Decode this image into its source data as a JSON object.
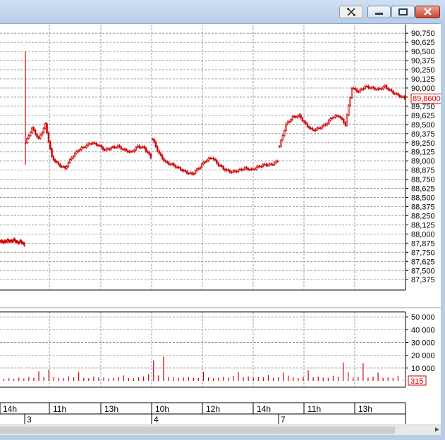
{
  "colors": {
    "candle": "#cc0000",
    "grid": "#888888",
    "text": "#000000",
    "current_price": "#cc0000"
  },
  "titlebar": {
    "icons": [
      "chart-layout-icon",
      "minimize-icon",
      "maximize-icon",
      "close-icon"
    ]
  },
  "chart_data": [
    {
      "type": "candlestick",
      "title": "",
      "ylim": [
        87.3,
        90.8
      ],
      "yticks": [
        "90,750",
        "90,625",
        "90,500",
        "90,375",
        "90,250",
        "90,125",
        "90,000",
        "89,875",
        "89,750",
        "89,625",
        "89,500",
        "89,375",
        "89,250",
        "89,125",
        "89,000",
        "88,875",
        "88,750",
        "88,625",
        "88,500",
        "88,375",
        "88,250",
        "88,125",
        "88,000",
        "87,875",
        "87,750",
        "87,625",
        "87,500",
        "87,375"
      ],
      "current_price_label": "89,8600",
      "current_price": 89.86,
      "grid": true,
      "series": [
        {
          "segment": "day 2 (previous)",
          "x": [
            0,
            35
          ],
          "close": [
            87.9,
            87.89,
            87.91,
            87.9,
            87.92,
            87.88,
            87.9,
            87.85
          ]
        },
        {
          "segment": "day 3",
          "x": [
            35,
            215
          ],
          "close": [
            89.25,
            89.45,
            89.3,
            89.5,
            89.05,
            88.95,
            88.9,
            89.05,
            89.15,
            89.2,
            89.25,
            89.22,
            89.15,
            89.18,
            89.2,
            89.15,
            89.12,
            89.2,
            89.18,
            89.05
          ]
        },
        {
          "segment": "day 4",
          "x": [
            215,
            395
          ],
          "close": [
            89.3,
            89.1,
            88.98,
            88.95,
            88.9,
            88.85,
            88.82,
            88.9,
            89.0,
            89.05,
            88.95,
            88.88,
            88.85,
            88.87,
            88.9,
            88.88,
            88.92,
            88.95,
            88.95,
            89.0
          ]
        },
        {
          "segment": "day 7",
          "x": [
            395,
            575
          ],
          "close": [
            89.2,
            89.5,
            89.6,
            89.62,
            89.5,
            89.42,
            89.45,
            89.5,
            89.6,
            89.62,
            89.5,
            90.0,
            89.95,
            90.02,
            90.0,
            89.98,
            90.02,
            89.95,
            89.9,
            89.86
          ]
        }
      ],
      "spike_high": 90.5,
      "spike_low": 88.95
    },
    {
      "type": "bar",
      "title": "",
      "ylim": [
        0,
        55000
      ],
      "yticks": [
        "50 000",
        "40 000",
        "30 000",
        "20 000",
        "10 000"
      ],
      "last_value_label": "315",
      "values": [
        1800,
        2100,
        1500,
        2600,
        1900,
        3200,
        2400,
        7500,
        3100,
        8800,
        2900,
        2500,
        2200,
        3600,
        2800,
        6800,
        2400,
        2100,
        3300,
        2700,
        2600,
        1900,
        2200,
        3100,
        4200,
        2300,
        2000,
        2700,
        3500,
        5200,
        16000,
        4200,
        19000,
        3100,
        2700,
        2400,
        2600,
        3000,
        2500,
        2200,
        7200,
        2800,
        2100,
        2400,
        3200,
        2600,
        3800,
        7000,
        2900,
        3400,
        2500,
        3100,
        2800,
        4500,
        2300,
        3000,
        6500,
        4100,
        2700,
        2200,
        3100,
        8200,
        2900,
        3400,
        2600,
        2500,
        4000,
        3300,
        14500,
        7000,
        2800,
        3100,
        13800,
        2500,
        3300,
        6500,
        2400,
        2700,
        2200,
        3900,
        315
      ]
    }
  ],
  "time_axis": {
    "hour_labels": [
      "14h",
      "11h",
      "13h",
      "10h",
      "12h",
      "14h",
      "11h",
      "13h"
    ],
    "day_labels": [
      "3",
      "4",
      "7"
    ]
  }
}
